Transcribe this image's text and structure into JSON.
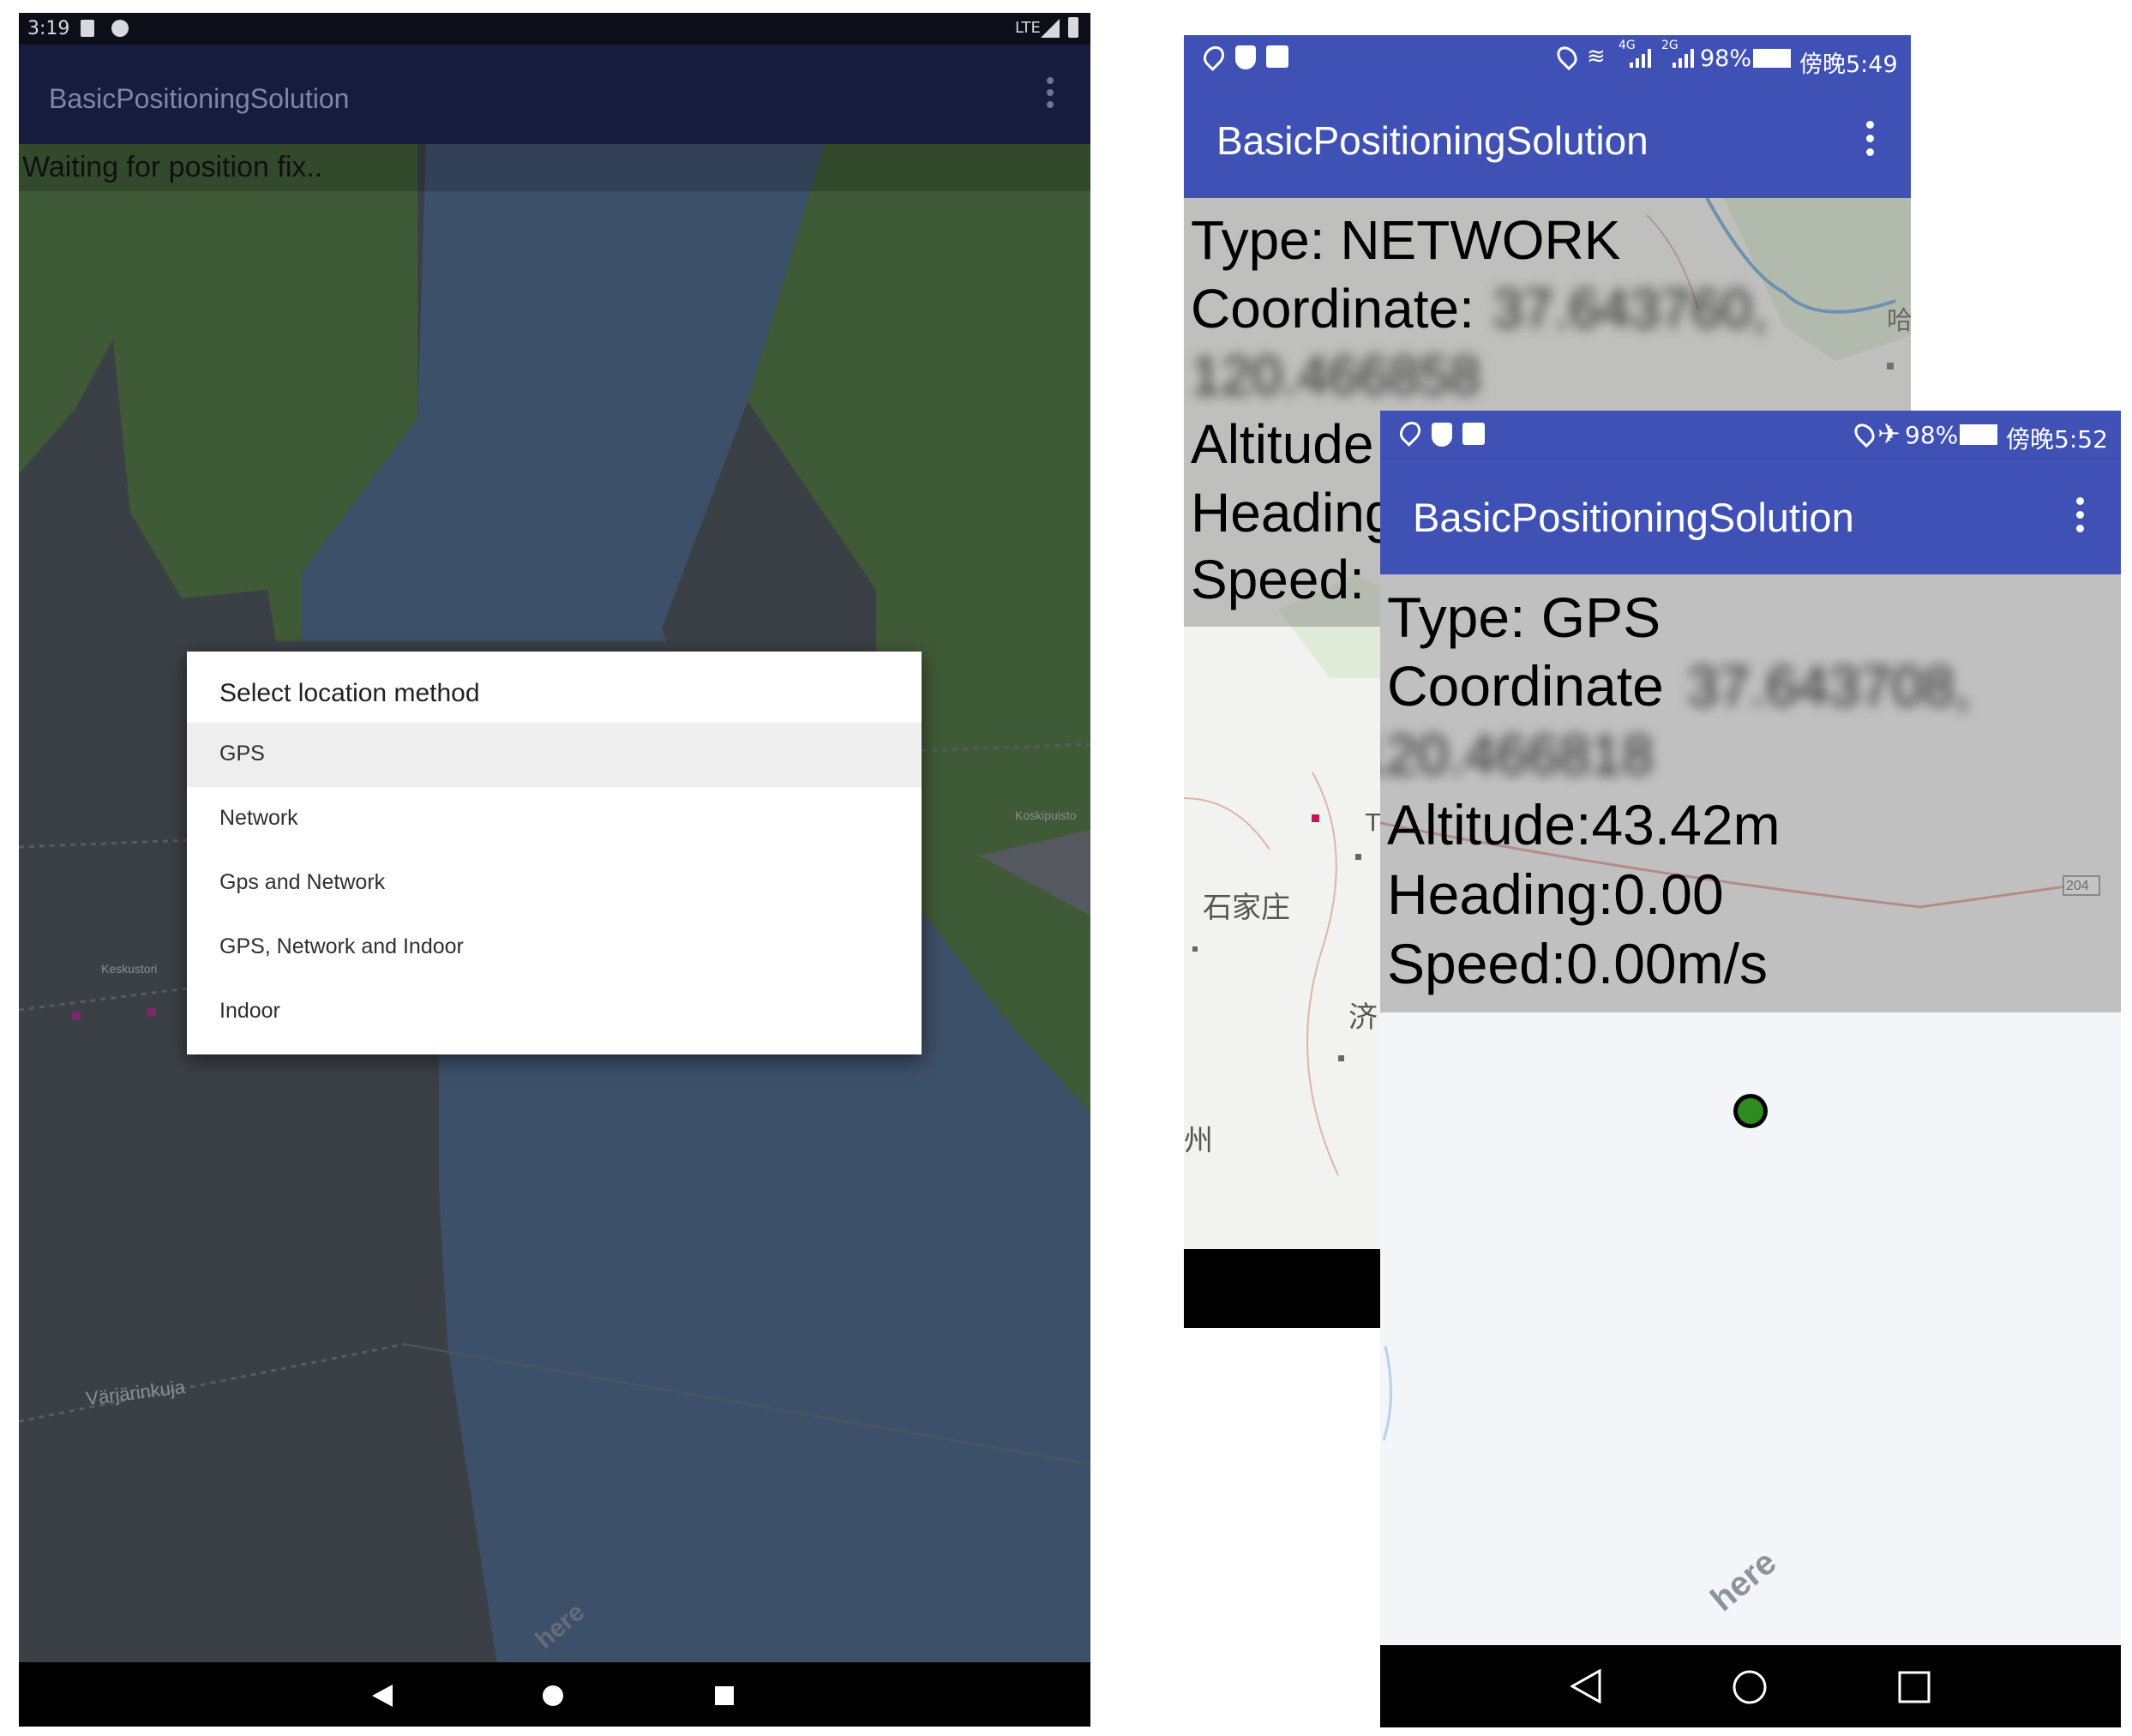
{
  "left_phone": {
    "status": {
      "time": "3:19",
      "network": "LTE"
    },
    "app_title": "BasicPositioningSolution",
    "waiting_text": "Waiting for position fix..",
    "dialog": {
      "title": "Select location method",
      "options": [
        "GPS",
        "Network",
        "Gps and Network",
        "GPS, Network and Indoor",
        "Indoor"
      ],
      "selected": "GPS"
    },
    "map_labels": {
      "street": "Värjärinkuja",
      "place1": "Keskustori",
      "place2": "Koskipuisto",
      "logo": "here"
    }
  },
  "mid_phone": {
    "status": {
      "battery": "98%",
      "time": "傍晚5:49",
      "net1": "4G",
      "net2": "2G"
    },
    "app_title": "BasicPositioningSolution",
    "info": {
      "type": "Type: NETWORK",
      "coordinate_label": "Coordinate:",
      "coordinate_lat": "37.643760,",
      "coordinate_lon": "120.466858",
      "altitude": "Altitude",
      "heading": "Heading",
      "speed": "Speed:"
    },
    "map_labels": {
      "city1": "石家庄",
      "city2": "济",
      "city3": "州",
      "city4": "哈",
      "partial": "T"
    }
  },
  "right_phone": {
    "status": {
      "battery": "98%",
      "time": "傍晚5:52"
    },
    "app_title": "BasicPositioningSolution",
    "info": {
      "type": "Type: GPS",
      "coordinate_label": "Coordinate",
      "coordinate_lat": "37.643708,",
      "coordinate_lon": "120.466818",
      "altitude": "Altitude:43.42m",
      "heading": "Heading:0.00",
      "speed": "Speed:0.00m/s"
    },
    "map_labels": {
      "road": "204",
      "logo": "here"
    }
  },
  "colors": {
    "accent": "#3f51b5",
    "dim_appbar": "#151c3e",
    "position_marker": "#2e8b1f"
  }
}
